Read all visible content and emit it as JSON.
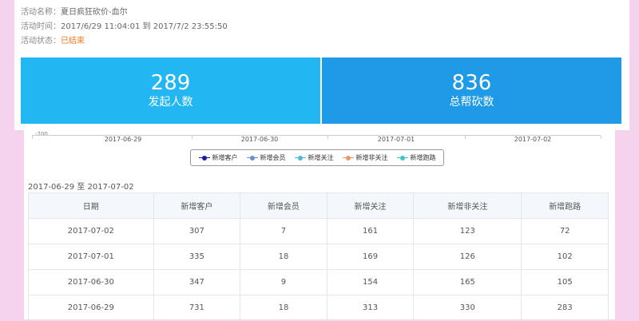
{
  "activity": {
    "name_label": "活动名称：",
    "name_value": "夏日疯狂砍价-血尔",
    "time_label": "活动时间：",
    "time_value": "2017/6/29 11:04:01 到 2017/7/2 23:55:50",
    "status_label": "活动状态：",
    "status_value": "已结束",
    "status_color": "#f0771d"
  },
  "stats": {
    "initiators_value": "289",
    "initiators_label": "发起人数",
    "helpers_value": "836",
    "helpers_label": "总帮砍数",
    "left_color": "#22b6f2",
    "right_color": "#1e9ae6"
  },
  "chart": {
    "y_min_label": "-200",
    "x_labels": [
      "2017-06-29",
      "2017-06-30",
      "2017-07-01",
      "2017-07-02"
    ]
  },
  "legend": {
    "items": [
      {
        "label": "新增客户",
        "color": "#1a1aa8"
      },
      {
        "label": "新增会员",
        "color": "#6a8fd0"
      },
      {
        "label": "新增关注",
        "color": "#4fb7dc"
      },
      {
        "label": "新增非关注",
        "color": "#f0956a"
      },
      {
        "label": "新增跑路",
        "color": "#3ec6c0"
      }
    ]
  },
  "range_text": "2017-06-29 至 2017-07-02",
  "table": {
    "headers": [
      "日期",
      "新增客户",
      "新增会员",
      "新增关注",
      "新增非关注",
      "新增跑路"
    ],
    "rows": [
      [
        "2017-07-02",
        "307",
        "7",
        "161",
        "123",
        "72"
      ],
      [
        "2017-07-01",
        "335",
        "18",
        "169",
        "126",
        "102"
      ],
      [
        "2017-06-30",
        "347",
        "9",
        "154",
        "165",
        "105"
      ],
      [
        "2017-06-29",
        "731",
        "18",
        "313",
        "330",
        "283"
      ]
    ]
  }
}
